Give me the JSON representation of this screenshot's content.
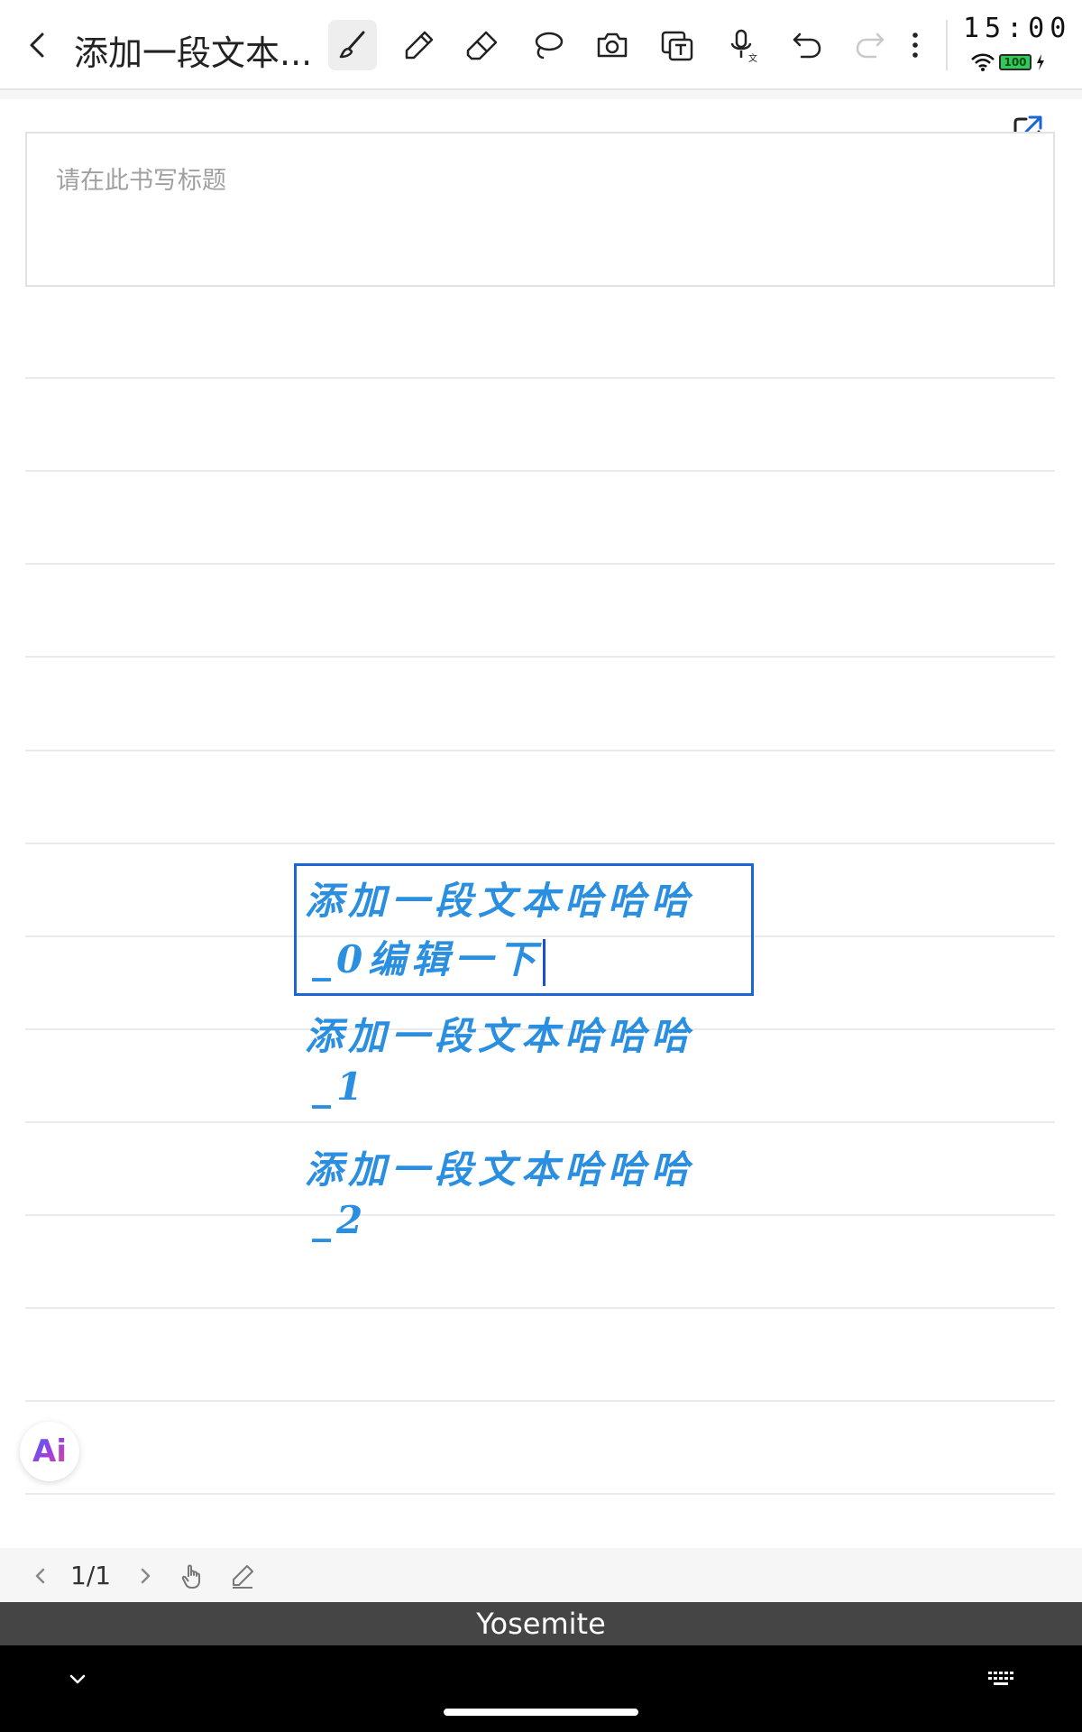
{
  "toolbar": {
    "title": "添加一段文本...",
    "tools": [
      {
        "name": "brush-icon",
        "active": true
      },
      {
        "name": "pen-icon",
        "active": false
      },
      {
        "name": "eraser-icon",
        "active": false
      },
      {
        "name": "lasso-icon",
        "active": false
      },
      {
        "name": "camera-icon",
        "active": false
      },
      {
        "name": "text-box-icon",
        "active": false
      },
      {
        "name": "microphone-icon",
        "active": false
      },
      {
        "name": "undo-icon",
        "active": false
      },
      {
        "name": "redo-icon",
        "active": false
      },
      {
        "name": "more-icon",
        "active": false
      }
    ]
  },
  "status": {
    "time": "15:00",
    "battery": "100"
  },
  "note": {
    "title_placeholder": "请在此书写标题",
    "handwriting": [
      {
        "line1": "添加一段文本哈哈哈",
        "line2": "_0编辑一下",
        "selected": true
      },
      {
        "line1": "添加一段文本哈哈哈",
        "line2": "_1",
        "selected": false
      },
      {
        "line1": "添加一段文本哈哈哈",
        "line2": "_2",
        "selected": false
      }
    ]
  },
  "ai_button": {
    "label": "Ai"
  },
  "pagebar": {
    "page": "1/1"
  },
  "keyboard": {
    "font_name": "Yosemite"
  },
  "colors": {
    "ink": "#2a8fe0",
    "selection": "#1a66d6"
  }
}
